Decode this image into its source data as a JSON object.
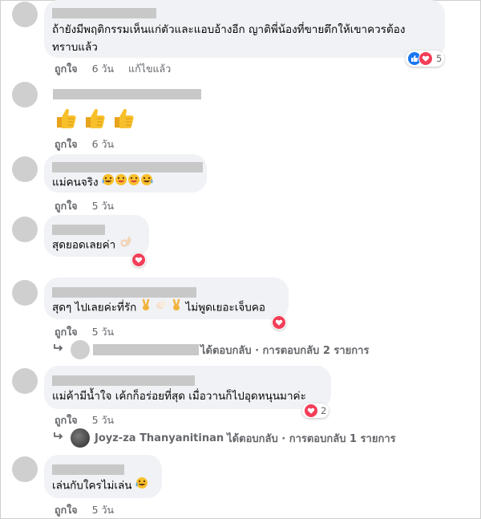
{
  "comments": [
    {
      "text_lines": [
        "ถ้ายังมีพฤติกรรมเห็นแก่ตัวและแอบอ้างอีก ญาติพี่น้องที่ขายตึกให้เขาควรต้อง",
        "ทราบแล้ว"
      ],
      "actions": {
        "like": "ถูกใจ",
        "time": "6 วัน",
        "edited": "แก้ไขแล้ว"
      },
      "reaction_count": "5"
    },
    {
      "actions": {
        "like": "ถูกใจ",
        "time": "6 วัน"
      }
    },
    {
      "text": "แม่คนจริง",
      "actions": {
        "like": "ถูกใจ",
        "time": "5 วัน"
      }
    },
    {
      "text": "สุดยอดเลยค่า",
      "actions": {
        "like": "ถูกใจ",
        "time": "5 วัน"
      }
    },
    {
      "text_a": "สุดๆ ไปเลยค่ะที่รัก",
      "text_b": "ไม่พูดเยอะเจ็บคอ",
      "actions": {
        "like": "ถูกใจ",
        "time": "5 วัน"
      },
      "reply": {
        "suffix": "ได้ตอบกลับ · การตอบกลับ 2 รายการ"
      }
    },
    {
      "text": "แม่ค้ามีน้ำใจ เค้กก็อร่อยที่สุด เมื่อวานก็ไปอุดหนุนมาค่ะ",
      "actions": {
        "like": "ถูกใจ",
        "time": "5 วัน"
      },
      "reaction_count": "2",
      "reply": {
        "name": "Joyz-za Thanyanitinan",
        "suffix": "ได้ตอบกลับ · การตอบกลับ 1 รายการ"
      }
    },
    {
      "text": "เล่นกับใครไม่เล่น",
      "actions": {
        "like": "ถูกใจ",
        "time": "5 วัน"
      }
    }
  ]
}
